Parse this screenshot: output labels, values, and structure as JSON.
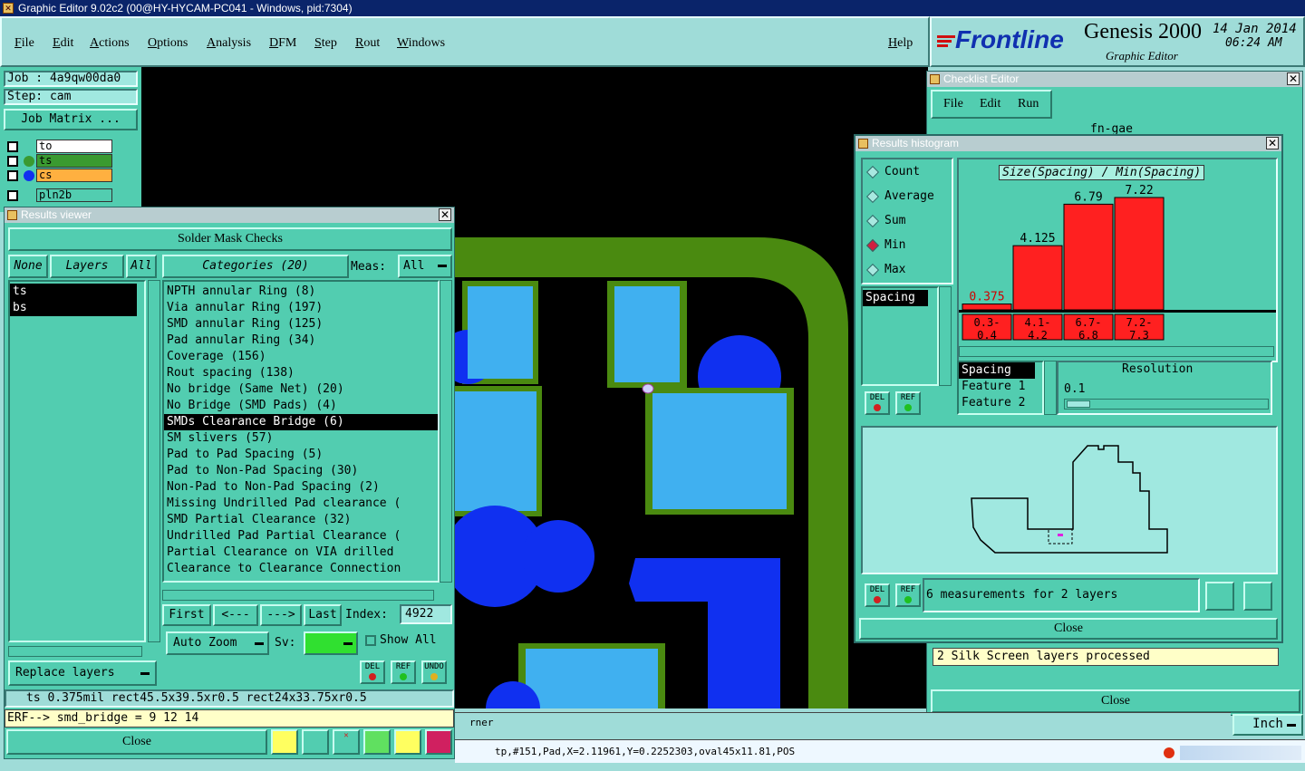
{
  "window": {
    "title": "Graphic Editor 9.02c2 (00@HY-HYCAM-PC041 - Windows, pid:7304)"
  },
  "menu": {
    "items": [
      "File",
      "Edit",
      "Actions",
      "Options",
      "Analysis",
      "DFM",
      "Step",
      "Rout",
      "Windows"
    ],
    "help": "Help"
  },
  "brand": {
    "logo": "Frontline",
    "product": "Genesis 2000",
    "subtitle": "Graphic Editor",
    "date": "14 Jan 2014",
    "time": "06:24 AM"
  },
  "job": {
    "job_label": "Job : 4a9qw00da0",
    "step_label": "Step: cam",
    "matrix_button": "Job Matrix ..."
  },
  "layers_panel": [
    {
      "name": "to",
      "color": "#ffffff"
    },
    {
      "name": "ts",
      "color": "#3a9a30"
    },
    {
      "name": "cs",
      "color": "#ffb040"
    },
    {
      "name": "pln2b",
      "color": "#52cdb0"
    }
  ],
  "results_viewer": {
    "title": "Results viewer",
    "header": "Solder Mask Checks",
    "none": "None",
    "layers": "Layers",
    "all": "All",
    "categories_btn": "Categories (20)",
    "meas_label": "Meas:",
    "meas_value": "All",
    "layer_list": [
      "ts",
      "bs"
    ],
    "categories": [
      "NPTH annular Ring (8)",
      "Via annular Ring (197)",
      "SMD annular Ring (125)",
      "Pad annular Ring (34)",
      "Coverage (156)",
      "Rout spacing (138)",
      "No bridge (Same Net) (20)",
      "No Bridge (SMD Pads) (4)",
      "SMDs Clearance Bridge (6)",
      "SM slivers (57)",
      "Pad to Pad Spacing (5)",
      "Pad to Non-Pad Spacing (30)",
      "Non-Pad to Non-Pad Spacing (2)",
      "Missing Undrilled Pad clearance (",
      "SMD Partial Clearance (32)",
      "Undrilled Pad Partial Clearance (",
      "Partial Clearance on VIA drilled",
      "Clearance to Clearance Connection"
    ],
    "selected_index": 8,
    "first": "First",
    "prev": "<---",
    "next": "--->",
    "last": "Last",
    "index_label": "Index:",
    "index_value": "4922",
    "auto_zoom": "Auto Zoom",
    "sv_label": "Sv:",
    "show_all": "Show All",
    "replace_layers": "Replace layers",
    "del": "DEL",
    "ref": "REF",
    "undo": "UNDO",
    "status": "ts 0.375mil  rect45.5x39.5xr0.5  rect24x33.75xr0.5",
    "erf": "ERF--> smd_bridge = 9 12 14",
    "close": "Close"
  },
  "checklist": {
    "title": "Checklist Editor",
    "menu": [
      "File",
      "Edit",
      "Run"
    ],
    "name": "fn-gae",
    "message": "2 Silk Screen layers processed",
    "close": "Close"
  },
  "histogram": {
    "title": "Results histogram",
    "modes": [
      "Count",
      "Average",
      "Sum",
      "Min",
      "Max"
    ],
    "selected_mode": "Min",
    "chart_title": "Size(Spacing) / Min(Spacing)",
    "list": [
      "Spacing"
    ],
    "field_list": [
      "Spacing",
      "Feature 1",
      "Feature 2"
    ],
    "resolution_label": "Resolution",
    "resolution_value": "0.1",
    "summary": "6 measurements for 2 layers",
    "close": "Close",
    "del": "DEL",
    "ref": "REF"
  },
  "chart_data": {
    "type": "bar",
    "title": "Size(Spacing) / Min(Spacing)",
    "categories": [
      "0.3-0.4",
      "4.1-4.2",
      "6.7-6.8",
      "7.2-7.3"
    ],
    "category_labels": [
      [
        "0.3-",
        "0.4"
      ],
      [
        "4.1-",
        "4.2"
      ],
      [
        "6.7-",
        "6.8"
      ],
      [
        "7.2-",
        "7.3"
      ]
    ],
    "values": [
      0.375,
      4.125,
      6.79,
      7.22
    ],
    "value_labels": [
      "0.375",
      "4.125",
      "6.79",
      "7.22"
    ],
    "ylim": [
      0,
      7.22
    ],
    "color": "#ff2020"
  },
  "bottom": {
    "corner_text": "rner",
    "units": "Inch",
    "coords": "tp,#151,Pad,X=2.11961,Y=0.2252303,oval45x11.81,POS"
  },
  "colors": {
    "panel": "#52cdb0",
    "background": "#9fdcd8",
    "canvas": "#000000",
    "trace_green": "#4a8a10",
    "pad_light": "#40b0f0",
    "pad_blue": "#1030f0",
    "bar_red": "#ff2020"
  }
}
